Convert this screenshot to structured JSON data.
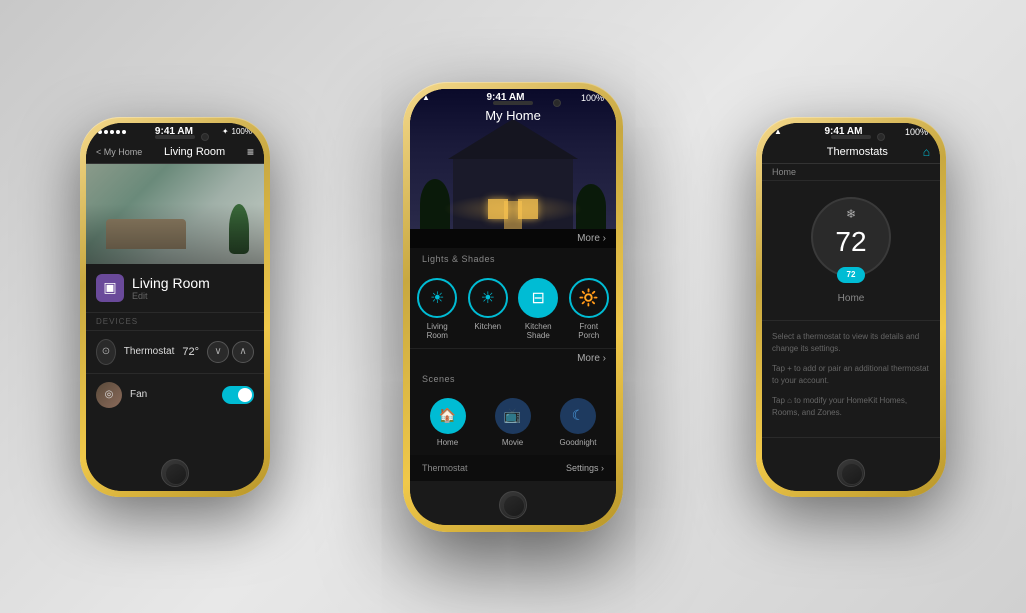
{
  "scene": {
    "bg_color": "#d8d8d8"
  },
  "phone1": {
    "status": {
      "signal": "●●●●●",
      "time": "9:41 AM",
      "battery": "100%",
      "bluetooth": "✦"
    },
    "header": {
      "back_label": "< My Home",
      "title": "Living Room",
      "menu_icon": "≡"
    },
    "room": {
      "icon": "▣",
      "name": "Living Room",
      "edit_label": "Edit"
    },
    "devices_label": "DEVICES",
    "devices": [
      {
        "name": "Thermostat",
        "temp": "72°",
        "controls": [
          "∨",
          "∧"
        ]
      },
      {
        "name": "Fan",
        "toggle_on": true
      }
    ]
  },
  "phone2": {
    "status": {
      "time": "9:41 AM",
      "battery": "100%",
      "wifi": "wifi"
    },
    "header": {
      "title": "My Home"
    },
    "hero": {
      "more_label": "More ›"
    },
    "lights_section": {
      "title": "Lights & Shades",
      "more_label": "More ›",
      "items": [
        {
          "label": "Living\nRoom",
          "icon": "☀",
          "active": false
        },
        {
          "label": "Kitchen",
          "icon": "☀",
          "active": false
        },
        {
          "label": "Kitchen\nShade",
          "icon": "⊟",
          "active": true
        },
        {
          "label": "Front\nPorch",
          "icon": "🔆",
          "active": false
        }
      ]
    },
    "scenes_section": {
      "title": "Scenes",
      "items": [
        {
          "label": "Home",
          "icon": "🏠",
          "active": true
        },
        {
          "label": "Movie",
          "icon": "📺",
          "active": false
        },
        {
          "label": "Goodnight",
          "icon": "☾",
          "active": false
        }
      ]
    },
    "footer": {
      "thermostat_label": "Thermostat",
      "settings_label": "Settings ›"
    }
  },
  "phone3": {
    "status": {
      "time": "9:41 AM",
      "battery": "100%",
      "wifi": "wifi"
    },
    "header": {
      "title": "Thermostats",
      "home_icon": "⌂"
    },
    "breadcrumb": "Home",
    "thermostat": {
      "temp": "72",
      "badge_temp": "72",
      "snowflake": "❄",
      "label": "Home"
    },
    "info": [
      "Select a thermostat to view its details and change its settings.",
      "Tap + to add or pair an additional thermostat to your account.",
      "Tap ⌂ to modify your HomeKit Homes, Rooms, and Zones."
    ]
  }
}
